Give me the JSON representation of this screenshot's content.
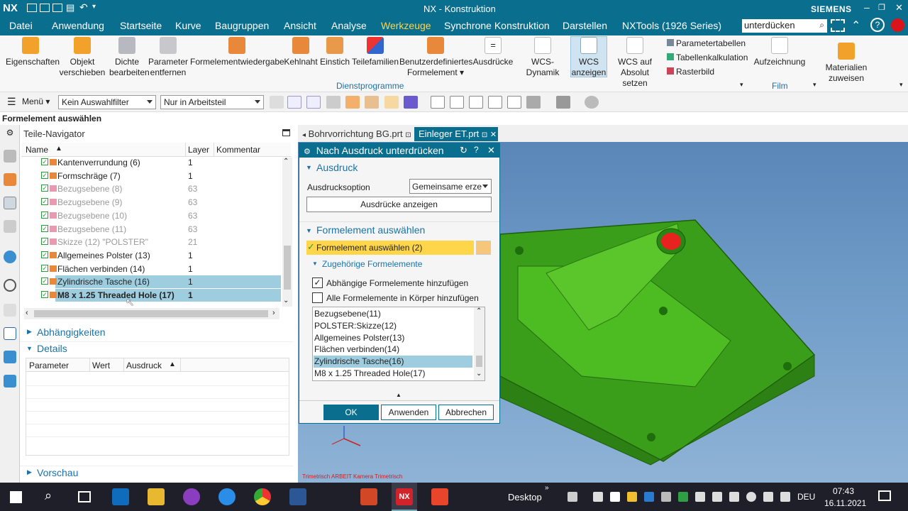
{
  "app": {
    "logo": "NX",
    "title": "NX - Konstruktion",
    "brand": "SIEMENS",
    "search_value": "unterdücken"
  },
  "menu": [
    "Datei",
    "Anwendung",
    "Startseite",
    "Kurve",
    "Baugruppen",
    "Ansicht",
    "Analyse",
    "Werkzeuge",
    "Synchrone Konstruktion",
    "Darstellen",
    "NXTools (1926 Series)"
  ],
  "menu_active": "Werkzeuge",
  "ribbon": {
    "items": [
      {
        "l1": "Eigenschaften",
        "l2": ""
      },
      {
        "l1": "Objekt",
        "l2": "verschieben"
      },
      {
        "l1": "Dichte",
        "l2": "bearbeiten"
      },
      {
        "l1": "Parameter",
        "l2": "entfernen"
      },
      {
        "l1": "Formelementwiedergabe",
        "l2": ""
      },
      {
        "l1": "Kehlnaht",
        "l2": ""
      },
      {
        "l1": "Einstich",
        "l2": ""
      },
      {
        "l1": "Teilefamilien",
        "l2": ""
      },
      {
        "l1": "Benutzerdefiniertes",
        "l2": "Formelement ▾"
      },
      {
        "l1": "Ausdrücke",
        "l2": ""
      },
      {
        "l1": "WCS-Dynamik",
        "l2": ""
      },
      {
        "l1": "WCS",
        "l2": "anzeigen"
      },
      {
        "l1": "WCS auf",
        "l2": "Absolut setzen"
      }
    ],
    "small_items": [
      "Parametertabellen",
      "Tabellenkalkulation",
      "Rasterbild"
    ],
    "film": "Aufzeichnung",
    "materials": {
      "l1": "Materialien",
      "l2": "zuweisen"
    },
    "group_labels": {
      "dienst": "Dienstprogramme",
      "film": "Film"
    }
  },
  "toolbar": {
    "menu_label": "Menü ▾",
    "filter": "Kein Auswahlfilter",
    "scope": "Nur in Arbeitsteil"
  },
  "status_line": "Formelement auswählen",
  "navigator": {
    "title": "Teile-Navigator",
    "columns": [
      "Name",
      "Layer",
      "Kommentar"
    ],
    "rows": [
      {
        "name": "Kantenverrundung (6)",
        "layer": "1",
        "dim": false,
        "sel": false,
        "bold": false
      },
      {
        "name": "Formschräge (7)",
        "layer": "1",
        "dim": false,
        "sel": false,
        "bold": false
      },
      {
        "name": "Bezugsebene (8)",
        "layer": "63",
        "dim": true,
        "sel": false,
        "bold": false
      },
      {
        "name": "Bezugsebene (9)",
        "layer": "63",
        "dim": true,
        "sel": false,
        "bold": false
      },
      {
        "name": "Bezugsebene (10)",
        "layer": "63",
        "dim": true,
        "sel": false,
        "bold": false
      },
      {
        "name": "Bezugsebene (11)",
        "layer": "63",
        "dim": true,
        "sel": false,
        "bold": false
      },
      {
        "name": "Skizze (12) \"POLSTER\"",
        "layer": "21",
        "dim": true,
        "sel": false,
        "bold": false
      },
      {
        "name": "Allgemeines Polster (13)",
        "layer": "1",
        "dim": false,
        "sel": false,
        "bold": false
      },
      {
        "name": "Flächen verbinden (14)",
        "layer": "1",
        "dim": false,
        "sel": false,
        "bold": false
      },
      {
        "name": "Zylindrische Tasche (16)",
        "layer": "1",
        "dim": false,
        "sel": true,
        "bold": false
      },
      {
        "name": "M8 x 1.25 Threaded Hole (17)",
        "layer": "1",
        "dim": false,
        "sel": true,
        "bold": true
      }
    ],
    "abh": "Abhängigkeiten",
    "details": "Details",
    "detail_cols": [
      "Parameter",
      "Wert",
      "Ausdruck"
    ],
    "vorschau": "Vorschau"
  },
  "tabs": [
    {
      "label": "Bohrvorrichtung BG.prt"
    },
    {
      "label": "Einleger ET.prt"
    }
  ],
  "dialog": {
    "title": "Nach Ausdruck unterdrücken",
    "sec1": "Ausdruck",
    "option_label": "Ausdrucksoption",
    "option_value": "Gemeinsame erze",
    "show_btn": "Ausdrücke anzeigen",
    "sec2": "Formelement auswählen",
    "select_row": "Formelement auswählen (2)",
    "sub": "Zugehörige Formelemente",
    "cb1": "Abhängige Formelemente hinzufügen",
    "cb2": "Alle Formelemente in Körper hinzufügen",
    "list": [
      "Bezugsebene(11)",
      "POLSTER:Skizze(12)",
      "Allgemeines Polster(13)",
      "Flächen verbinden(14)",
      "Zylindrische Tasche(16)",
      "M8 x 1.25 Threaded Hole(17)"
    ],
    "selected_index": 4,
    "ok": "OK",
    "apply": "Anwenden",
    "cancel": "Abbrechen"
  },
  "viewport_caption": "Trimetrisch ARBEIT Kamera Trimetrisch",
  "taskbar": {
    "desktop": "Desktop",
    "lang": "DEU",
    "time": "07:43",
    "date": "16.11.2021"
  },
  "colors": {
    "accent": "#0a6e8e",
    "model": "#3fae1f",
    "highlight": "#ffd54a"
  }
}
